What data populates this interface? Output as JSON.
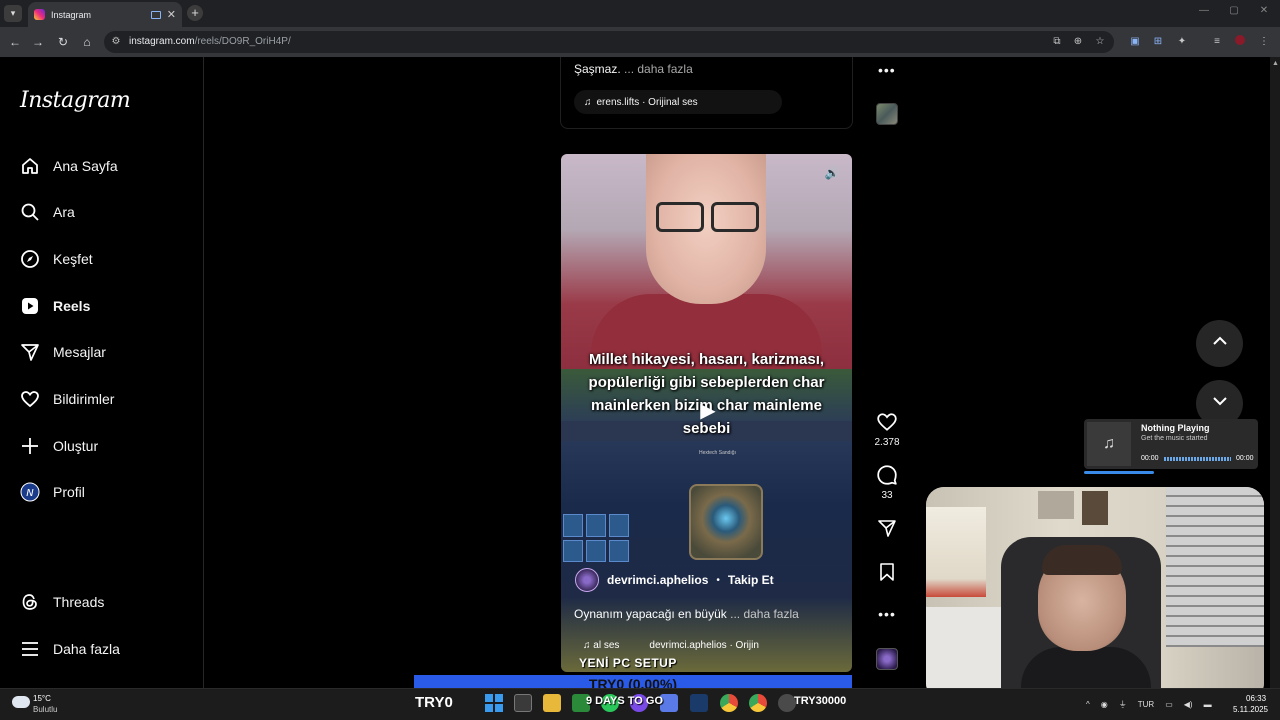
{
  "browser": {
    "tab_title": "Instagram",
    "url_host": "instagram.com",
    "url_path": "/reels/DO9R_OriH4P/"
  },
  "sidebar": {
    "logo": "Instagram",
    "items": [
      {
        "label": "Ana Sayfa",
        "icon": "home-icon"
      },
      {
        "label": "Ara",
        "icon": "search-icon"
      },
      {
        "label": "Keşfet",
        "icon": "compass-icon"
      },
      {
        "label": "Reels",
        "icon": "reels-icon"
      },
      {
        "label": "Mesajlar",
        "icon": "messages-icon"
      },
      {
        "label": "Bildirimler",
        "icon": "heart-icon"
      },
      {
        "label": "Oluştur",
        "icon": "plus-icon"
      },
      {
        "label": "Profil",
        "icon": "profile-avatar-icon"
      }
    ],
    "bottom_items": [
      {
        "label": "Threads",
        "icon": "threads-icon"
      },
      {
        "label": "Daha fazla",
        "icon": "menu-icon"
      }
    ]
  },
  "previous_reel": {
    "caption": "Şaşmaz.",
    "more_label": "... daha fazla",
    "audio": "erens.lifts · Orijinal ses"
  },
  "current_reel": {
    "subtitle_line1": "Millet hikayesi, hasarı, karizması,",
    "subtitle_line2": "popülerliği gibi sebeplerden char",
    "subtitle_line3": "mainlerken bizim char mainleme sebebi",
    "game_title": "Hextech Sandığı",
    "username": "devrimci.aphelios",
    "separator": "•",
    "follow_label": "Takip Et",
    "caption": "Oynanım yapacağı en büyük",
    "more_label": "... daha fazla",
    "audio_left": "al ses",
    "audio_right": "devrimci.aphelios · Orijin",
    "overlay_text": "YENİ PC SETUP",
    "likes": "2.378",
    "comments": "33"
  },
  "music_widget": {
    "title": "Nothing Playing",
    "subtitle": "Get the music started",
    "time_start": "00:00",
    "time_end": "00:00",
    "progress": 0.4
  },
  "stream_overlay": {
    "ticker": "TRY0 (0.00%)",
    "left_label": "TRY0",
    "days_label": "9 DAYS TO GO",
    "right_label": "TRY30000"
  },
  "taskbar": {
    "temperature": "15°C",
    "weather": "Bulutlu",
    "language": "TUR",
    "time": "06:33",
    "date": "5.11.2025"
  },
  "colors": {
    "accent_blue": "#2a5ae8",
    "background": "#000000"
  }
}
